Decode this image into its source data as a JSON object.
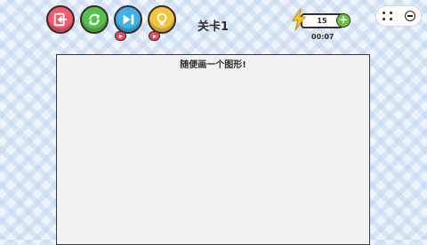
{
  "header": {
    "level_label": "关卡1",
    "energy_value": "15",
    "timer": "00:07"
  },
  "buttons": {
    "back": "back-icon",
    "restart": "refresh-icon",
    "skip": "skip-icon",
    "hint": "lightbulb-icon"
  },
  "canvas": {
    "prompt": "随便画一个图形!"
  },
  "colors": {
    "back": "#ef5b6f",
    "restart": "#55c14d",
    "skip": "#3fb1e6",
    "hint": "#f3c53c",
    "energy": "#f5c32c",
    "plus": "#66c53c"
  }
}
